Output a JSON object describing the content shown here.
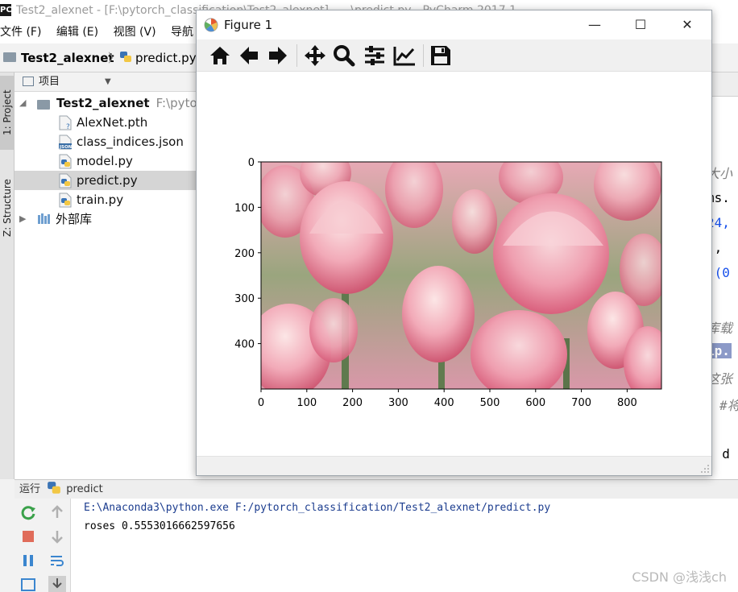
{
  "ide": {
    "title": "Test2_alexnet - [F:\\pytorch_classification\\Test2_alexnet] - ...\\predict.py - PyCharm 2017.1",
    "menu": [
      "文件 (F)",
      "编辑 (E)",
      "视图 (V)",
      "导航 (N"
    ],
    "breadcrumb": {
      "project": "Test2_alexnet",
      "file": "predict.py"
    }
  },
  "side_tabs": {
    "project": "1: Project",
    "structure": "Z: Structure"
  },
  "project_panel": {
    "header": "项目",
    "root": {
      "name": "Test2_alexnet",
      "path": "F:\\pytorch"
    },
    "files": [
      "AlexNet.pth",
      "class_indices.json",
      "model.py",
      "predict.py",
      "train.py"
    ],
    "selected": "predict.py",
    "external": "外部库"
  },
  "editor_fragments": [
    "大小",
    "ms.",
    "24,",
    "),",
    "((0",
    "库载",
    "ip.",
    "这张",
    "#将",
    ", d"
  ],
  "figure": {
    "title": "Figure 1",
    "toolbar": [
      "home-icon",
      "back-icon",
      "forward-icon",
      "pan-icon",
      "zoom-icon",
      "configure-subplots-icon",
      "edit-axis-icon",
      "save-icon"
    ],
    "window_buttons": {
      "minimize": "—",
      "maximize": "☐",
      "close": "✕"
    }
  },
  "run": {
    "label": "运行",
    "config": "predict",
    "lines": [
      "E:\\Anaconda3\\python.exe F:/pytorch_classification/Test2_alexnet/predict.py",
      "roses 0.5553016662597656"
    ]
  },
  "watermark": "CSDN @浅浅ch",
  "chart_data": {
    "type": "image",
    "x_ticks": [
      0,
      100,
      200,
      300,
      400,
      500,
      600,
      700,
      800
    ],
    "y_ticks": [
      0,
      100,
      200,
      300,
      400
    ],
    "xlim": [
      0,
      875
    ],
    "ylim": [
      500,
      0
    ],
    "image_subject": "pink tulips"
  },
  "colors": {
    "link_blue": "#1c3d8f",
    "selected_row": "#d5d5d5",
    "highlight": "#8c9ac8"
  }
}
